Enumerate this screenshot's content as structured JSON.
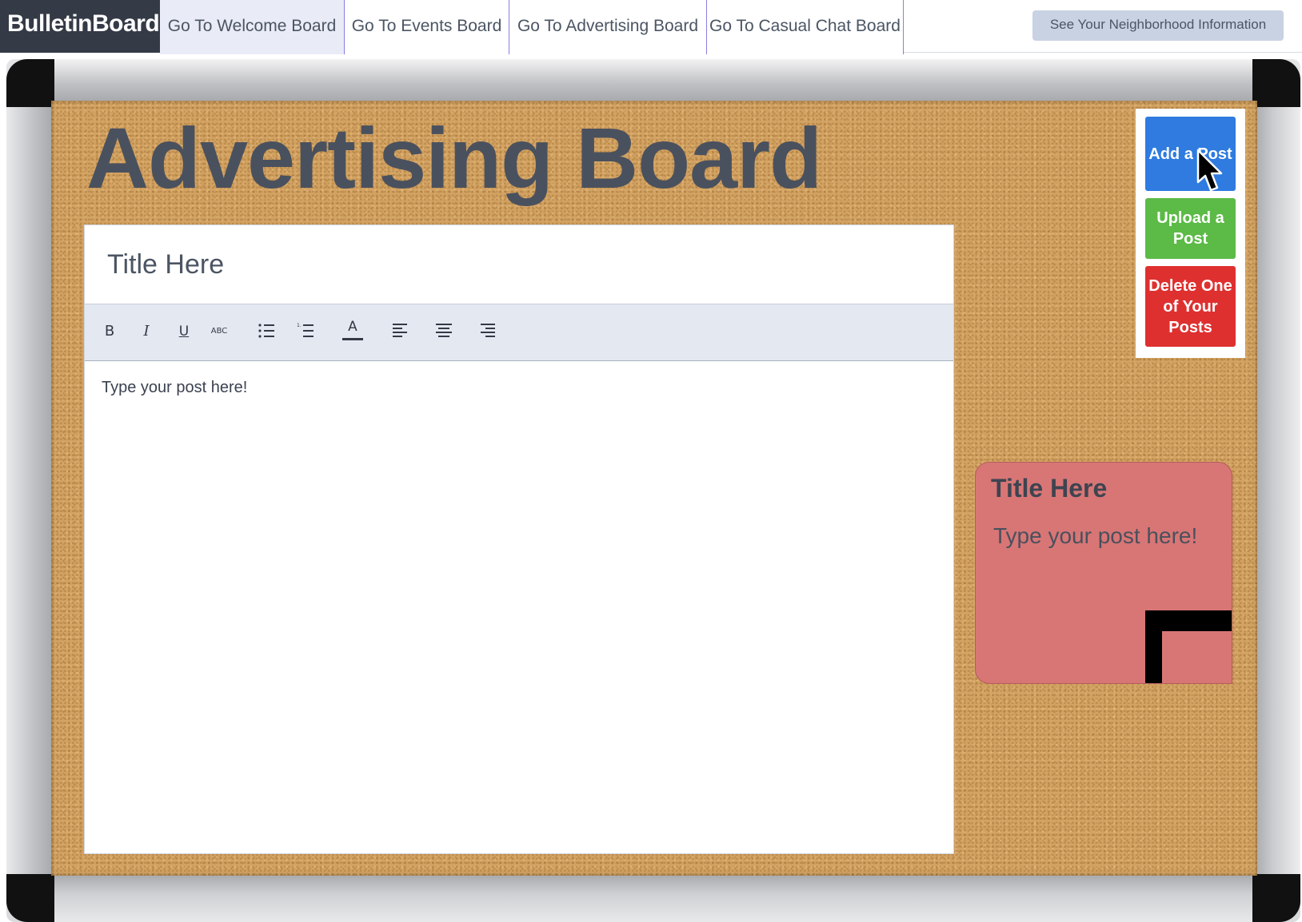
{
  "nav": {
    "brand": "BulletinBoard",
    "tabs": [
      {
        "label": "Go To Welcome Board",
        "active": true
      },
      {
        "label": "Go To Events Board",
        "active": false
      },
      {
        "label": "Go To Advertising Board",
        "active": false
      },
      {
        "label": "Go To Casual Chat Board",
        "active": false
      }
    ],
    "neighborhood_button": "See Your Neighborhood Information"
  },
  "board": {
    "title": "Advertising Board"
  },
  "editor": {
    "title_placeholder": "Title Here",
    "body_placeholder": "Type your post here!",
    "toolbar": [
      {
        "icon": "bold-icon",
        "glyph": "B"
      },
      {
        "icon": "italic-icon",
        "glyph": "I"
      },
      {
        "icon": "underline-icon",
        "glyph": "U"
      },
      {
        "icon": "strikethrough-icon",
        "glyph": "ABC"
      },
      {
        "icon": "bullet-list-icon"
      },
      {
        "icon": "numbered-list-icon"
      },
      {
        "icon": "text-color-icon",
        "glyph": "A"
      },
      {
        "icon": "align-left-icon"
      },
      {
        "icon": "align-center-icon"
      },
      {
        "icon": "align-right-icon"
      }
    ]
  },
  "actions": {
    "add_post": "Add a Post",
    "upload_post": "Upload a Post",
    "delete_post": "Delete One of Your Posts"
  },
  "sticky_note": {
    "title": "Title Here",
    "body": "Type your post here!",
    "color": "#d87676"
  },
  "colors": {
    "add": "#2f7be0",
    "upload": "#5cba47",
    "delete": "#df3030",
    "brand_bg": "#343a46",
    "cork": "#d3a363"
  }
}
